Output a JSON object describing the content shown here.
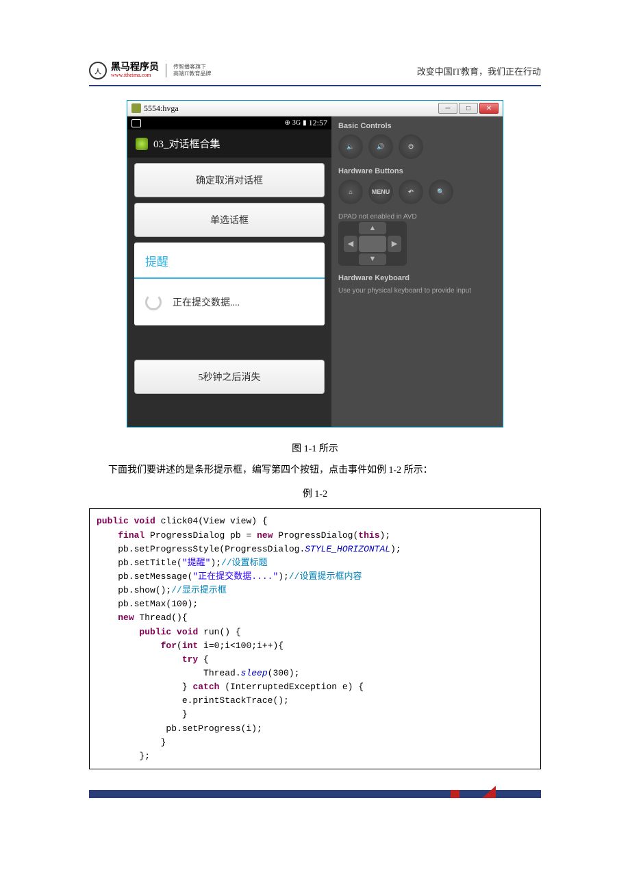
{
  "header": {
    "logo_main": "黑马程序员",
    "logo_url": "www.itheima.com",
    "logo_sub1": "传智播客旗下",
    "logo_sub2": "高端IT教育品牌",
    "slogan": "改变中国IT教育，我们正在行动"
  },
  "emulator": {
    "title": "5554:hvga",
    "status_time": "12:57",
    "status_network": "3G",
    "app_title": "03_对话框合集",
    "btn1": "确定取消对话框",
    "btn2": "单选话框",
    "dialog_title": "提醒",
    "dialog_msg": "正在提交数据....",
    "btn3": "5秒钟之后消失",
    "side": {
      "basic": "Basic Controls",
      "hw_buttons": "Hardware Buttons",
      "menu": "MENU",
      "dpad_note": "DPAD not enabled in AVD",
      "kb_title": "Hardware Keyboard",
      "kb_note": "Use your physical keyboard to provide input"
    }
  },
  "captions": {
    "fig": "图 1-1 所示",
    "para": "下面我们要讲述的是条形提示框，编写第四个按钮，点击事件如例 1-2 所示：",
    "code_label": "例 1-2"
  },
  "code": {
    "l1a": "public",
    "l1b": "void",
    "l1c": " click04(View view) {",
    "l2a": "final",
    "l2b": " ProgressDialog pb = ",
    "l2c": "new",
    "l2d": " ProgressDialog(",
    "l2e": "this",
    "l2f": ");",
    "l3a": "    pb.setProgressStyle(ProgressDialog.",
    "l3b": "STYLE_HORIZONTAL",
    "l3c": ");",
    "l4a": "    pb.setTitle(",
    "l4b": "\"提醒\"",
    "l4c": ");",
    "l4d": "//设置标题",
    "l5a": "    pb.setMessage(",
    "l5b": "\"正在提交数据....\"",
    "l5c": ");",
    "l5d": "//设置提示框内容",
    "l6a": "    pb.show();",
    "l6b": "//显示提示框",
    "l7": "    pb.setMax(100);",
    "l8a": "new",
    "l8b": " Thread(){",
    "l9a": "public",
    "l9b": "void",
    "l9c": " run() {",
    "l10a": "for",
    "l10b": "(",
    "l10c": "int",
    "l10d": " i=0;i<100;i++){",
    "l11a": "try",
    "l11b": " {",
    "l12a": "                    Thread.",
    "l12b": "sleep",
    "l12c": "(300);",
    "l13a": "                } ",
    "l13b": "catch",
    "l13c": " (InterruptedException e) {",
    "l14": "                e.printStackTrace();",
    "l15": "                }",
    "l16": "             pb.setProgress(i);",
    "l17": "            }",
    "l18": "        };"
  }
}
